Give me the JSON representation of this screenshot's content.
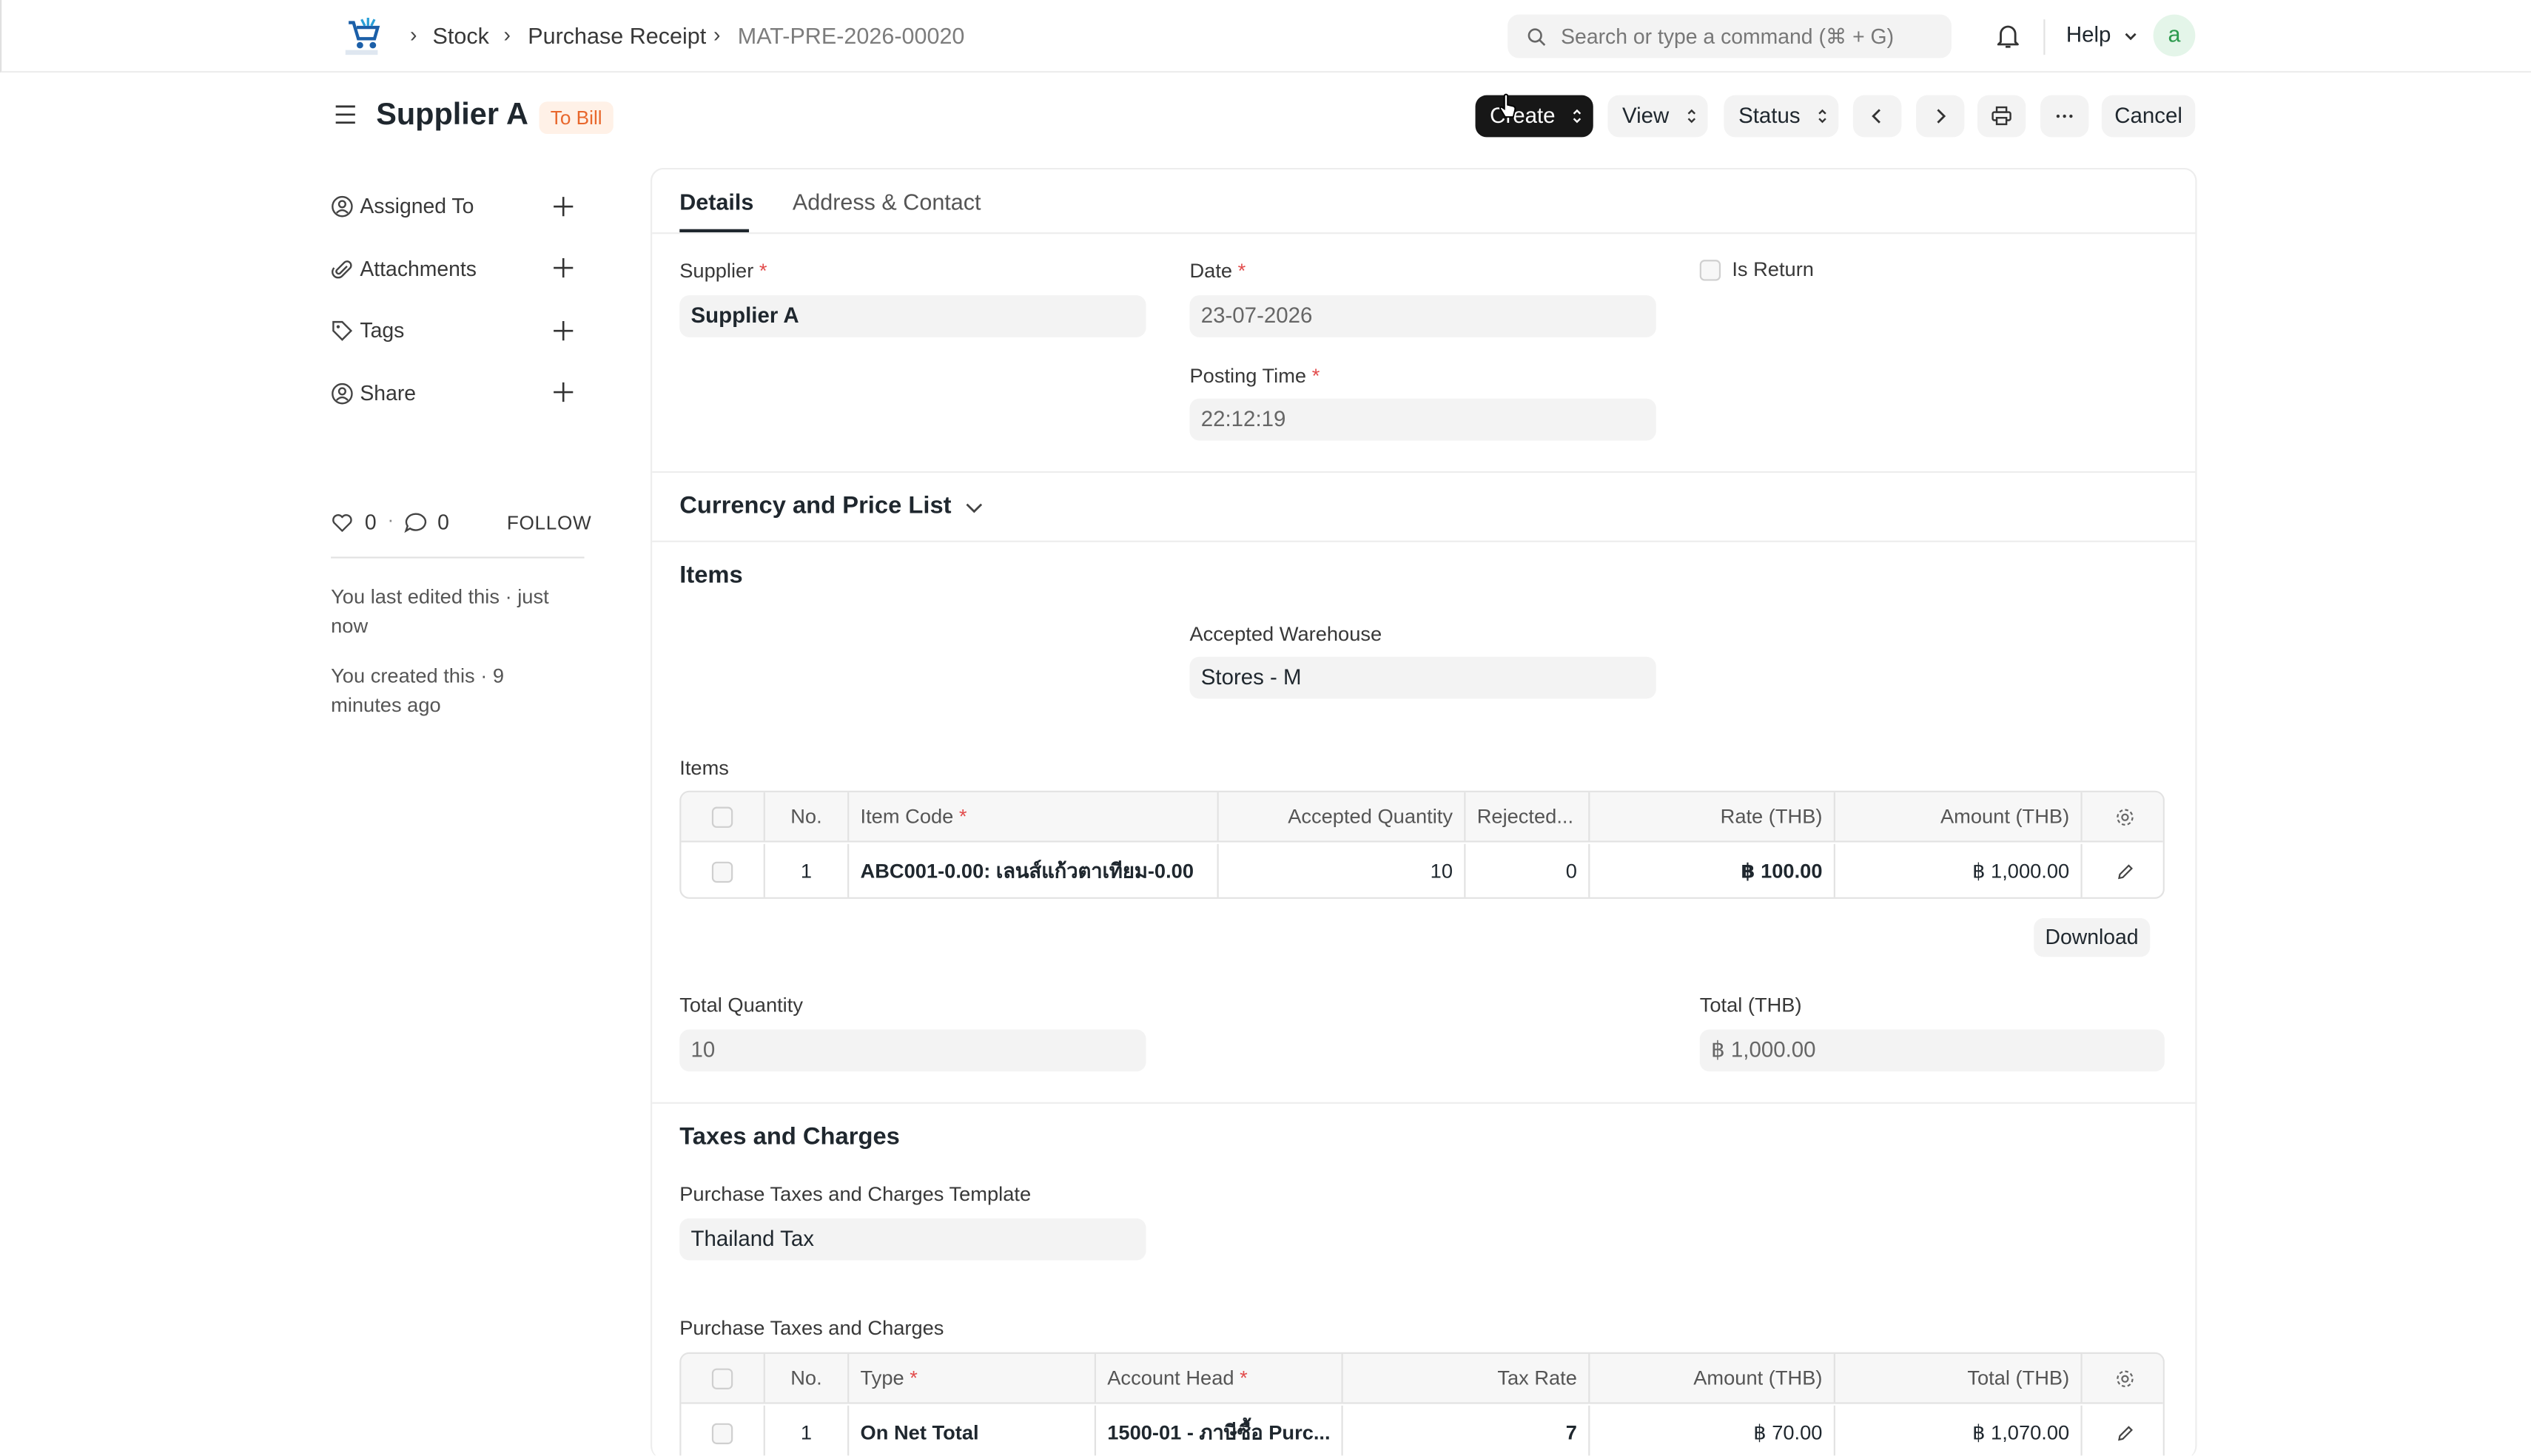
{
  "breadcrumbs": [
    "Stock",
    "Purchase Receipt",
    "MAT-PRE-2026-00020"
  ],
  "search": {
    "placeholder": "Search or type a command (⌘ + G)"
  },
  "navbar": {
    "help_label": "Help",
    "avatar_letter": "a"
  },
  "page": {
    "title": "Supplier A",
    "status_badge": "To Bill",
    "status_color": "#e8672c"
  },
  "toolbar": {
    "create_label": "Create",
    "view_label": "View",
    "status_label": "Status",
    "cancel_label": "Cancel"
  },
  "sidebar": {
    "items": [
      {
        "label": "Assigned To",
        "icon": "assign-icon"
      },
      {
        "label": "Attachments",
        "icon": "paperclip-icon"
      },
      {
        "label": "Tags",
        "icon": "tag-icon"
      },
      {
        "label": "Share",
        "icon": "share-icon"
      }
    ],
    "likes": "0",
    "comments": "0",
    "follow_label": "FOLLOW",
    "last_edited": "You last edited this · just now",
    "created": "You created this · 9 minutes ago"
  },
  "tabs": [
    "Details",
    "Address & Contact"
  ],
  "details": {
    "supplier_label": "Supplier",
    "supplier_value": "Supplier A",
    "date_label": "Date",
    "date_value": "23-07-2026",
    "posting_time_label": "Posting Time",
    "posting_time_value": "22:12:19",
    "is_return_label": "Is Return"
  },
  "currency_section": {
    "title": "Currency and Price List"
  },
  "items_section": {
    "title": "Items",
    "warehouse_label": "Accepted Warehouse",
    "warehouse_value": "Stores - M",
    "table_label": "Items",
    "columns": [
      "No.",
      "Item Code",
      "Accepted Quantity",
      "Rejected...",
      "Rate (THB)",
      "Amount (THB)"
    ],
    "rows": [
      {
        "no": "1",
        "item_code": "ABC001-0.00: เลนส์แก้วตาเทียม-0.00",
        "accepted_qty": "10",
        "rejected": "0",
        "rate": "฿ 100.00",
        "amount": "฿ 1,000.00"
      }
    ],
    "download_label": "Download",
    "total_qty_label": "Total Quantity",
    "total_qty_value": "10",
    "total_label": "Total (THB)",
    "total_value": "฿ 1,000.00"
  },
  "taxes_section": {
    "title": "Taxes and Charges",
    "template_label": "Purchase Taxes and Charges Template",
    "template_value": "Thailand Tax",
    "table_label": "Purchase Taxes and Charges",
    "columns": [
      "No.",
      "Type",
      "Account Head",
      "Tax Rate",
      "Amount (THB)",
      "Total (THB)"
    ],
    "rows": [
      {
        "no": "1",
        "type": "On Net Total",
        "account_head": "1500-01 - ภาษีซื้อ Purc...",
        "tax_rate": "7",
        "amount": "฿ 70.00",
        "total": "฿ 1,070.00"
      }
    ]
  }
}
